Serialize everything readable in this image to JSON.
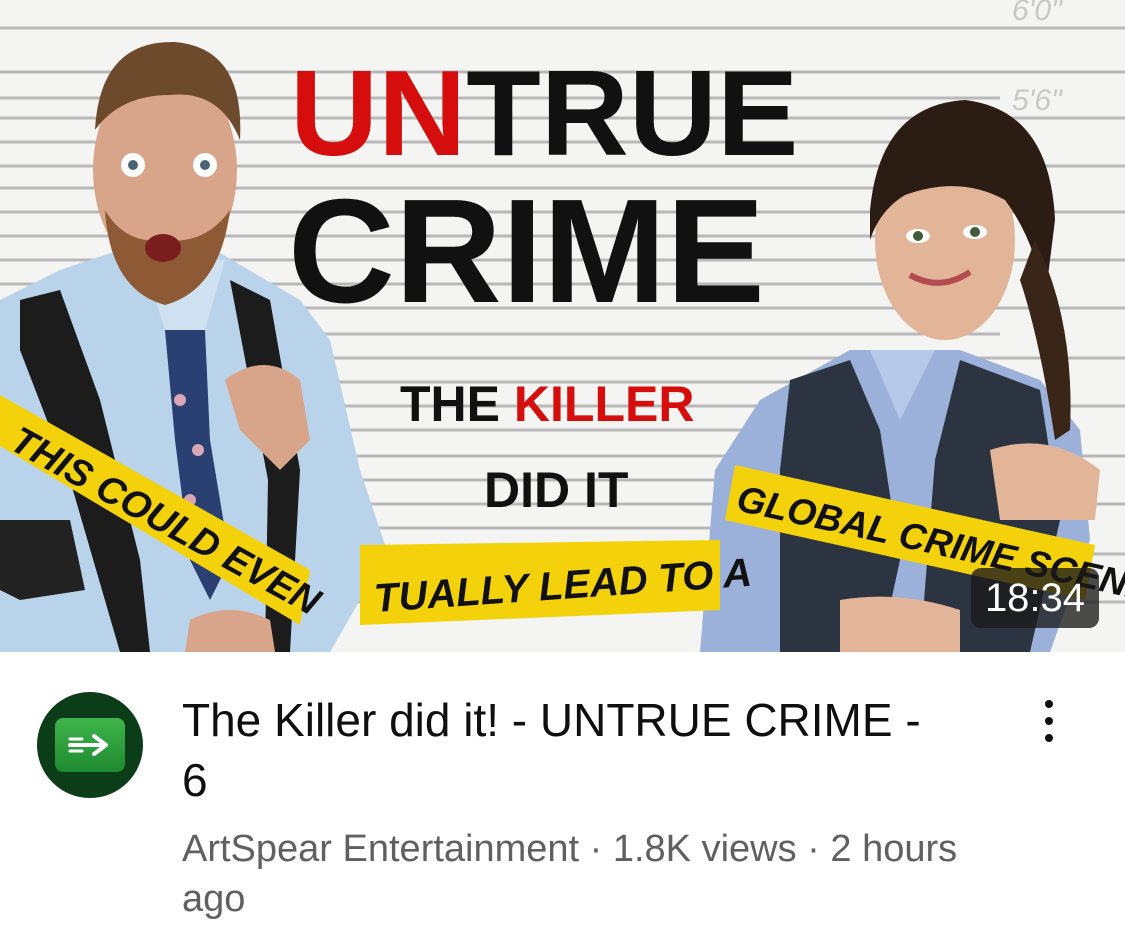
{
  "thumbnail": {
    "height_marks": [
      "6'0\"",
      "5'6\""
    ],
    "title_red": "UN",
    "title_black": "TRUE",
    "title_line2": "CRIME",
    "sub_black_1": "THE ",
    "sub_red": "KILLER",
    "sub_line2": "DID IT",
    "tape_left": "THIS COULD EVEN",
    "tape_middle": "TUALLY LEAD TO A",
    "tape_right": "GLOBAL CRIME SCENE",
    "duration": "18:34",
    "colors": {
      "title_red": "#d60d0d",
      "tape_yellow": "#f4d20b",
      "background": "#f4f4f2"
    }
  },
  "video": {
    "title": "The Killer did it! - UNTRUE CRIME - 6",
    "channel": "ArtSpear Entertainment",
    "views": "1.8K views",
    "age": "2 hours ago",
    "subtitle": "ArtSpear Entertainment · 1.8K views · 2 hours ago"
  },
  "icons": {
    "channel_avatar": "arrow-right-icon",
    "menu": "more-vert-icon"
  }
}
